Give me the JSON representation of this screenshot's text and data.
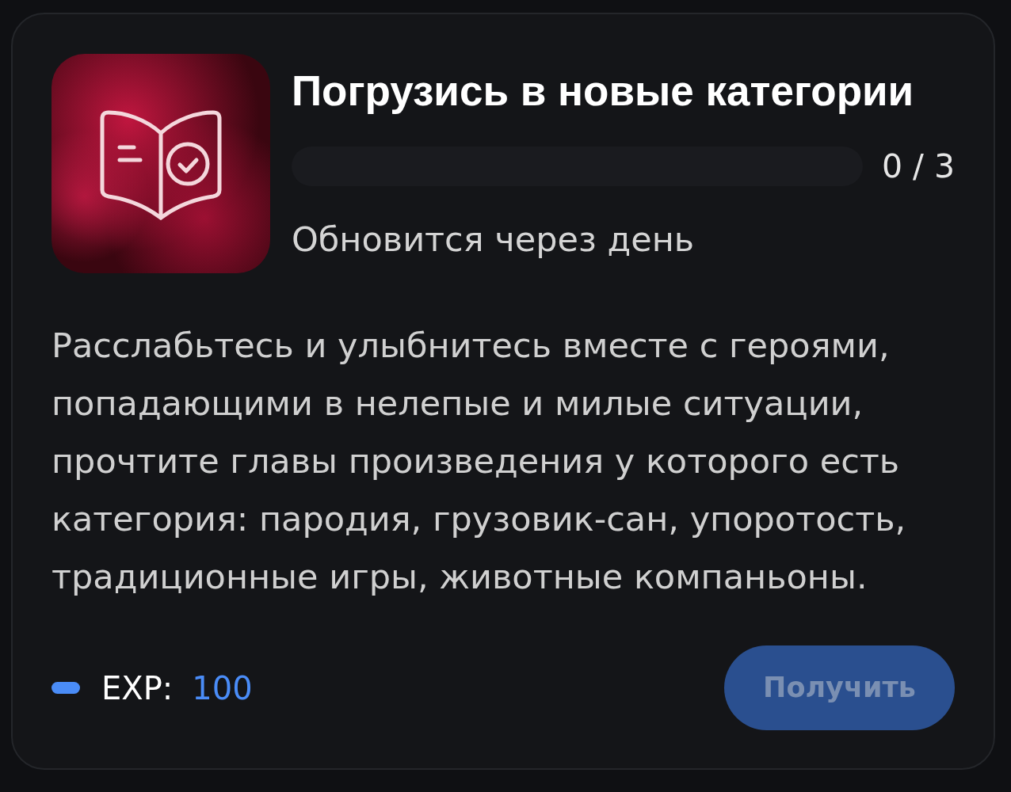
{
  "quest": {
    "title": "Погрузись в новые категории",
    "progress": {
      "level": 0,
      "reading": "0 / 3"
    },
    "refresh_note": "Обновится через день",
    "description": "Расслабьтесь и улыбнитесь вместе с героями, попадающими в нелепые и милые ситуации, прочтите главы произведения у которого есть категория: пародия, грузовик-сан, упоротость, традиционные игры, животные компаньоны.",
    "reward": {
      "label": "EXP:",
      "value": "100",
      "color": "#4a8cf7"
    },
    "claim_button": {
      "label": "Получить",
      "disabled": true
    }
  }
}
